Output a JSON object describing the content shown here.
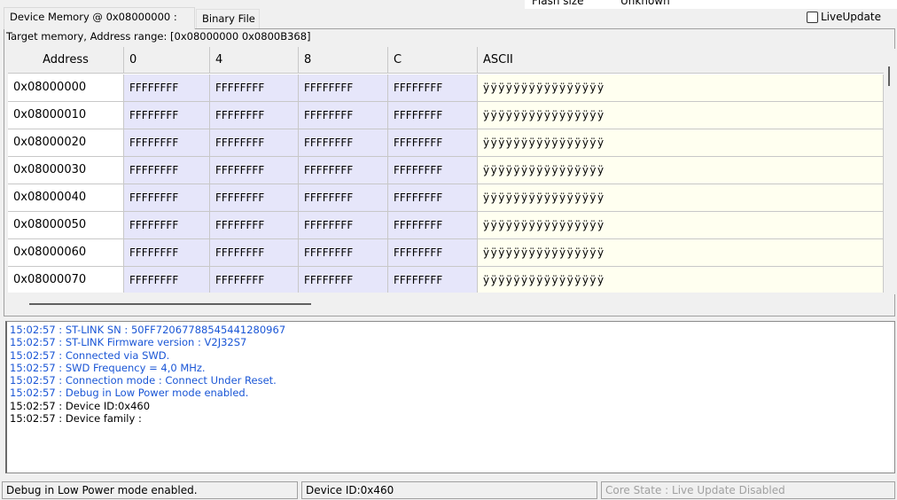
{
  "top_info": {
    "label": "Flash size",
    "value": "Unknown"
  },
  "tabs": [
    {
      "label": "Device Memory @ 0x08000000 :",
      "active": true
    },
    {
      "label": "Binary File",
      "active": false
    }
  ],
  "live_update": {
    "label": "LiveUpdate",
    "checked": false
  },
  "range_label": "Target memory, Address range: [0x08000000 0x0800B368]",
  "grid": {
    "headers": [
      "Address",
      "0",
      "4",
      "8",
      "C",
      "ASCII"
    ],
    "rows": [
      {
        "address": "0x08000000",
        "w0": "FFFFFFFF",
        "w4": "FFFFFFFF",
        "w8": "FFFFFFFF",
        "wc": "FFFFFFFF",
        "ascii": "ÿÿÿÿÿÿÿÿÿÿÿÿÿÿÿÿ"
      },
      {
        "address": "0x08000010",
        "w0": "FFFFFFFF",
        "w4": "FFFFFFFF",
        "w8": "FFFFFFFF",
        "wc": "FFFFFFFF",
        "ascii": "ÿÿÿÿÿÿÿÿÿÿÿÿÿÿÿÿ"
      },
      {
        "address": "0x08000020",
        "w0": "FFFFFFFF",
        "w4": "FFFFFFFF",
        "w8": "FFFFFFFF",
        "wc": "FFFFFFFF",
        "ascii": "ÿÿÿÿÿÿÿÿÿÿÿÿÿÿÿÿ"
      },
      {
        "address": "0x08000030",
        "w0": "FFFFFFFF",
        "w4": "FFFFFFFF",
        "w8": "FFFFFFFF",
        "wc": "FFFFFFFF",
        "ascii": "ÿÿÿÿÿÿÿÿÿÿÿÿÿÿÿÿ"
      },
      {
        "address": "0x08000040",
        "w0": "FFFFFFFF",
        "w4": "FFFFFFFF",
        "w8": "FFFFFFFF",
        "wc": "FFFFFFFF",
        "ascii": "ÿÿÿÿÿÿÿÿÿÿÿÿÿÿÿÿ"
      },
      {
        "address": "0x08000050",
        "w0": "FFFFFFFF",
        "w4": "FFFFFFFF",
        "w8": "FFFFFFFF",
        "wc": "FFFFFFFF",
        "ascii": "ÿÿÿÿÿÿÿÿÿÿÿÿÿÿÿÿ"
      },
      {
        "address": "0x08000060",
        "w0": "FFFFFFFF",
        "w4": "FFFFFFFF",
        "w8": "FFFFFFFF",
        "wc": "FFFFFFFF",
        "ascii": "ÿÿÿÿÿÿÿÿÿÿÿÿÿÿÿÿ"
      },
      {
        "address": "0x08000070",
        "w0": "FFFFFFFF",
        "w4": "FFFFFFFF",
        "w8": "FFFFFFFF",
        "wc": "FFFFFFFF",
        "ascii": "ÿÿÿÿÿÿÿÿÿÿÿÿÿÿÿÿ"
      }
    ]
  },
  "log": {
    "lines": [
      {
        "text": "15:02:57 : ST-LINK SN : 50FF72067788545441280967",
        "color": "#1a56d6"
      },
      {
        "text": "15:02:57 : ST-LINK Firmware version : V2J32S7",
        "color": "#1a56d6"
      },
      {
        "text": "15:02:57 : Connected via SWD.",
        "color": "#1a56d6"
      },
      {
        "text": "15:02:57 : SWD Frequency = 4,0 MHz.",
        "color": "#1a56d6"
      },
      {
        "text": "15:02:57 : Connection mode : Connect Under Reset.",
        "color": "#1a56d6"
      },
      {
        "text": "15:02:57 : Debug in Low Power mode enabled.",
        "color": "#1a56d6"
      },
      {
        "text": "15:02:57 : Device ID:0x460",
        "color": "#000000"
      },
      {
        "text": "15:02:57 : Device family :",
        "color": "#000000"
      }
    ]
  },
  "status": {
    "left": "Debug in Low Power mode enabled.",
    "middle": "Device ID:0x460",
    "right": "Core State : Live Update Disabled",
    "right_color": "#a0a0a0"
  }
}
